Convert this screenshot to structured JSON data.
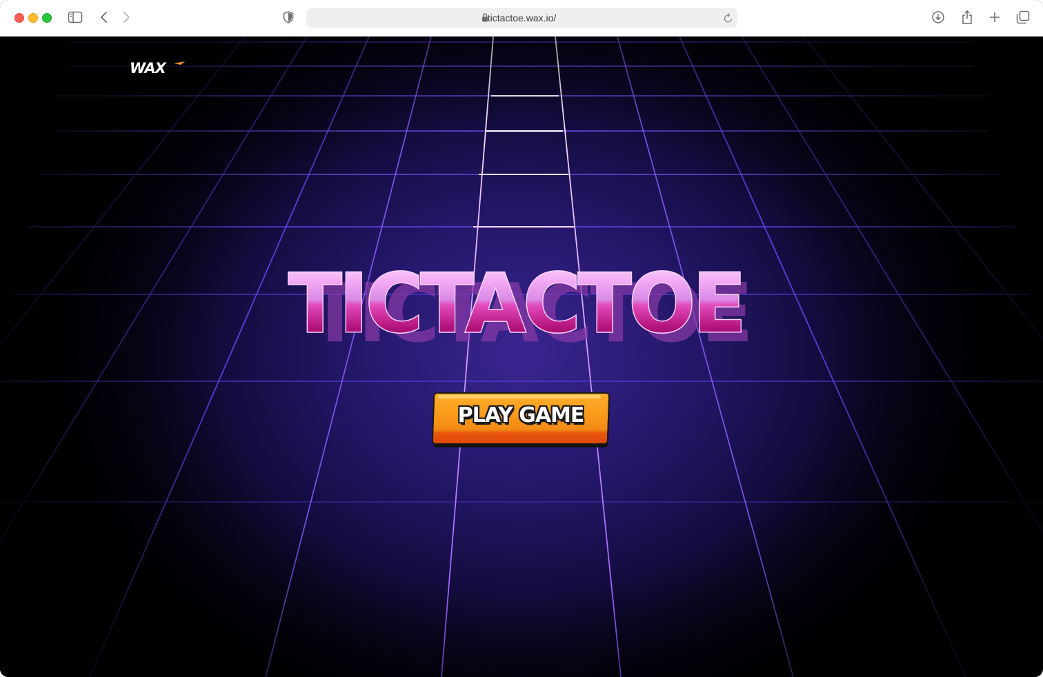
{
  "browser": {
    "url": "tictactoe.wax.io/",
    "icons": {
      "sidebar": "sidebar-icon",
      "back": "chevron-left-icon",
      "forward": "chevron-right-icon",
      "privacy": "shield-icon",
      "lock": "lock-icon",
      "reload": "reload-icon",
      "download": "download-icon",
      "share": "share-icon",
      "new_tab": "plus-icon",
      "tabs": "tabs-overview-icon"
    }
  },
  "page": {
    "logo_text": "WAX",
    "title": "TICTACTOE",
    "play_button_label": "PLAY GAME",
    "colors": {
      "accent_orange": "#f28b14",
      "grid_purple": "#6a4cff",
      "title_pink": "#c41d8a"
    }
  }
}
